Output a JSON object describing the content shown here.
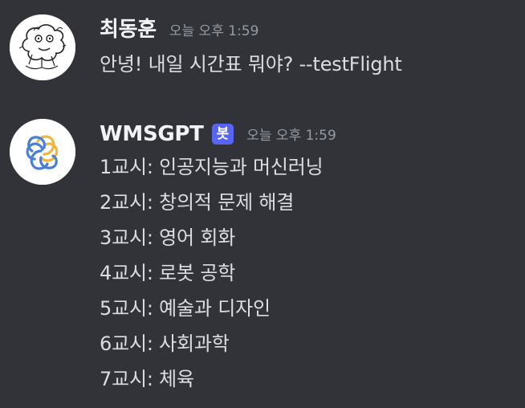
{
  "messages": [
    {
      "author": "최동훈",
      "timestamp": "오늘 오후 1:59",
      "avatar_icon": "doodle-avatar-icon",
      "lines": [
        "안녕! 내일 시간표 뭐야? --testFlight"
      ]
    },
    {
      "author": "WMSGPT",
      "badge": "봇",
      "timestamp": "오늘 오후 1:59",
      "avatar_icon": "openai-logo-icon",
      "lines": [
        "1교시: 인공지능과 머신러닝",
        "2교시: 창의적 문제 해결",
        "3교시: 영어 회화",
        "4교시: 로봇 공학",
        "5교시: 예술과 디자인",
        "6교시: 사회과학",
        "7교시: 체육"
      ]
    }
  ],
  "colors": {
    "background": "#313338",
    "username": "#f2f3f5",
    "timestamp": "#949ba4",
    "message_text": "#dbdee1",
    "bot_badge": "#5865f2"
  }
}
